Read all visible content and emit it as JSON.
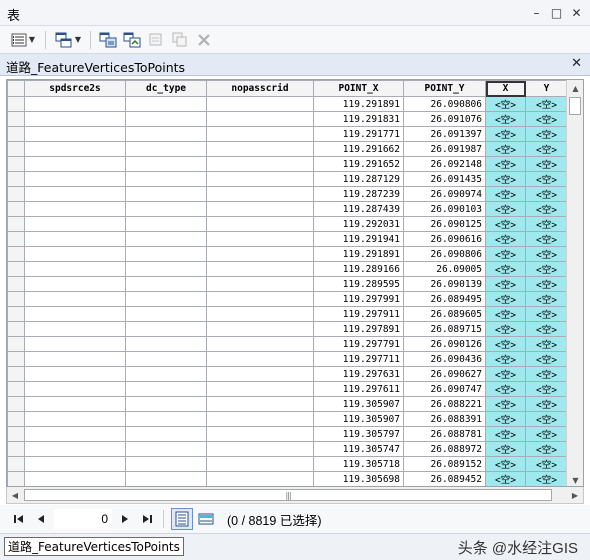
{
  "window": {
    "title": "表",
    "minimize": "–",
    "maximize": "□",
    "close": "✕"
  },
  "layer_tab": {
    "name": "道路_FeatureVerticesToPoints",
    "close": "✕"
  },
  "table": {
    "columns": [
      "",
      "spdsrce2s",
      "dc_type",
      "nopasscrid",
      "POINT_X",
      "POINT_Y",
      "X",
      "Y"
    ],
    "null_text": "<空>",
    "rows": [
      [
        "119.291891",
        "26.090806"
      ],
      [
        "119.291831",
        "26.091076"
      ],
      [
        "119.291771",
        "26.091397"
      ],
      [
        "119.291662",
        "26.091987"
      ],
      [
        "119.291652",
        "26.092148"
      ],
      [
        "119.287129",
        "26.091435"
      ],
      [
        "119.287239",
        "26.090974"
      ],
      [
        "119.287439",
        "26.090103"
      ],
      [
        "119.292031",
        "26.090125"
      ],
      [
        "119.291941",
        "26.090616"
      ],
      [
        "119.291891",
        "26.090806"
      ],
      [
        "119.289166",
        "26.09005"
      ],
      [
        "119.289595",
        "26.090139"
      ],
      [
        "119.297991",
        "26.089495"
      ],
      [
        "119.297911",
        "26.089605"
      ],
      [
        "119.297891",
        "26.089715"
      ],
      [
        "119.297791",
        "26.090126"
      ],
      [
        "119.297711",
        "26.090436"
      ],
      [
        "119.297631",
        "26.090627"
      ],
      [
        "119.297611",
        "26.090747"
      ],
      [
        "119.305907",
        "26.088221"
      ],
      [
        "119.305907",
        "26.088391"
      ],
      [
        "119.305797",
        "26.088781"
      ],
      [
        "119.305747",
        "26.088972"
      ],
      [
        "119.305718",
        "26.089152"
      ],
      [
        "119.305698",
        "26.089452"
      ]
    ]
  },
  "navigation": {
    "record_value": "0",
    "selection_status": "(0 / 8819 已选择)"
  },
  "bottom_tab": {
    "label": "道路_FeatureVerticesToPoints"
  },
  "watermark": "头条 @水经注GIS"
}
